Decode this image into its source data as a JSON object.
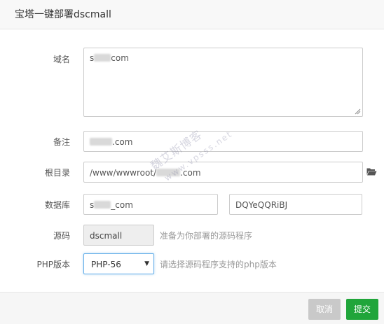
{
  "dialog": {
    "title": "宝塔一键部署dscmall"
  },
  "form": {
    "domain": {
      "label": "域名",
      "prefix": "s",
      "suffix": "com"
    },
    "remark": {
      "label": "备注",
      "suffix": ".com"
    },
    "root": {
      "label": "根目录",
      "prefix": "/www/wwwroot/",
      "suffix": ".com",
      "icon": "folder-open-icon"
    },
    "database": {
      "label": "数据库",
      "name_prefix": "s",
      "name_suffix": "_com",
      "password": "DQYeQQRiBJ"
    },
    "source": {
      "label": "源码",
      "value": "dscmall",
      "hint": "准备为你部署的源码程序"
    },
    "php": {
      "label": "PHP版本",
      "selected": "PHP-56",
      "hint": "请选择源码程序支持的php版本"
    }
  },
  "watermark": {
    "line1": "魏艾斯博客",
    "line2": "www.vpsss.net"
  },
  "footer": {
    "cancel_label": "取消",
    "submit_label": "提交"
  },
  "colors": {
    "submit": "#20a53a",
    "cancel": "#c9c9c9",
    "focus_border": "#66afe9"
  }
}
